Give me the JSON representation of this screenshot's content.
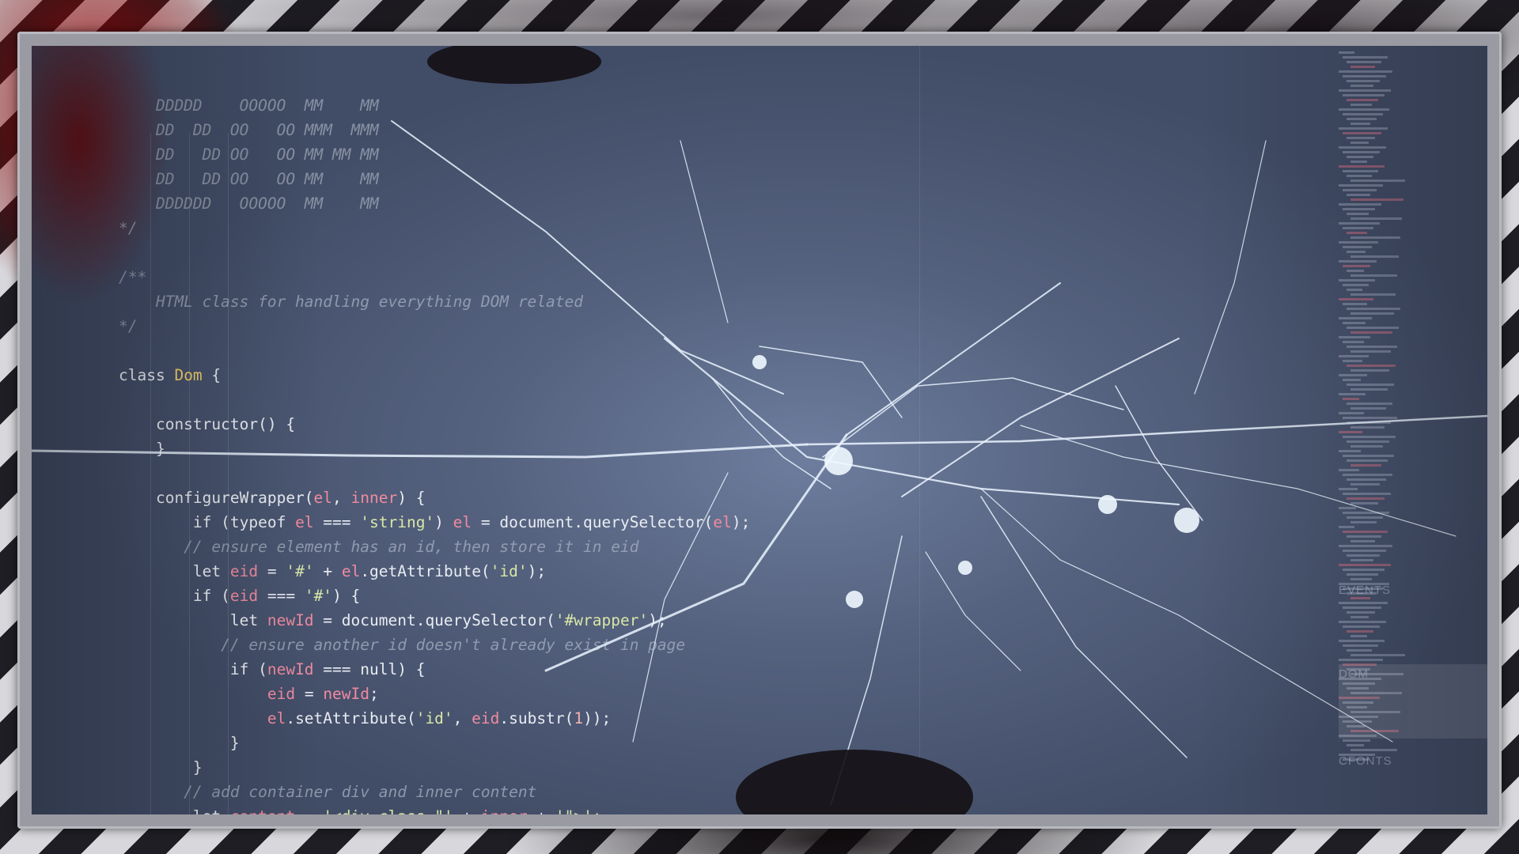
{
  "code_lines": [
    {
      "segs": [
        {
          "t": "    DDDDD    OOOOO  MM    MM",
          "c": "dim"
        }
      ]
    },
    {
      "segs": [
        {
          "t": "    DD  DD  OO   OO MMM  MMM",
          "c": "dim"
        }
      ]
    },
    {
      "segs": [
        {
          "t": "    DD   DD OO   OO MM MM MM",
          "c": "dim"
        }
      ]
    },
    {
      "segs": [
        {
          "t": "    DD   DD OO   OO MM    MM",
          "c": "dim"
        }
      ]
    },
    {
      "segs": [
        {
          "t": "    DDDDDD   OOOOO  MM    MM",
          "c": "dim"
        }
      ]
    },
    {
      "segs": [
        {
          "t": "*/",
          "c": "dim"
        }
      ]
    },
    {
      "segs": []
    },
    {
      "segs": [
        {
          "t": "/**",
          "c": "dim"
        }
      ]
    },
    {
      "segs": [
        {
          "t": "    HTML class for handling everything DOM related",
          "c": "cmt"
        }
      ]
    },
    {
      "segs": [
        {
          "t": "*/",
          "c": "dim"
        }
      ]
    },
    {
      "segs": []
    },
    {
      "segs": [
        {
          "t": "class ",
          "c": "kw"
        },
        {
          "t": "Dom",
          "c": "cls"
        },
        {
          "t": " {",
          "c": "kw"
        }
      ]
    },
    {
      "segs": []
    },
    {
      "segs": [
        {
          "t": "    constructor() {",
          "c": "fn"
        }
      ]
    },
    {
      "segs": [
        {
          "t": "    }",
          "c": "fn"
        }
      ]
    },
    {
      "segs": []
    },
    {
      "segs": [
        {
          "t": "    configureWrapper(",
          "c": "fn"
        },
        {
          "t": "el",
          "c": "var"
        },
        {
          "t": ", ",
          "c": "fn"
        },
        {
          "t": "inner",
          "c": "var"
        },
        {
          "t": ") {",
          "c": "fn"
        }
      ]
    },
    {
      "segs": [
        {
          "t": "        if (typeof ",
          "c": "kw"
        },
        {
          "t": "el",
          "c": "var"
        },
        {
          "t": " === ",
          "c": "kw"
        },
        {
          "t": "'string'",
          "c": "str"
        },
        {
          "t": ") ",
          "c": "kw"
        },
        {
          "t": "el",
          "c": "var"
        },
        {
          "t": " = ",
          "c": "kw"
        },
        {
          "t": "document",
          "c": "fn"
        },
        {
          "t": ".querySelector(",
          "c": "fn"
        },
        {
          "t": "el",
          "c": "var"
        },
        {
          "t": ");",
          "c": "fn"
        }
      ]
    },
    {
      "segs": [
        {
          "t": "       // ensure element has an id, then store it in eid",
          "c": "cmt"
        }
      ]
    },
    {
      "segs": [
        {
          "t": "        let ",
          "c": "kw"
        },
        {
          "t": "eid",
          "c": "var"
        },
        {
          "t": " = ",
          "c": "kw"
        },
        {
          "t": "'#'",
          "c": "str"
        },
        {
          "t": " + ",
          "c": "kw"
        },
        {
          "t": "el",
          "c": "var"
        },
        {
          "t": ".getAttribute(",
          "c": "fn"
        },
        {
          "t": "'id'",
          "c": "str"
        },
        {
          "t": ");",
          "c": "fn"
        }
      ]
    },
    {
      "segs": [
        {
          "t": "        if (",
          "c": "kw"
        },
        {
          "t": "eid",
          "c": "var"
        },
        {
          "t": " === ",
          "c": "kw"
        },
        {
          "t": "'#'",
          "c": "str"
        },
        {
          "t": ") {",
          "c": "kw"
        }
      ]
    },
    {
      "segs": [
        {
          "t": "            let ",
          "c": "kw"
        },
        {
          "t": "newId",
          "c": "var"
        },
        {
          "t": " = ",
          "c": "kw"
        },
        {
          "t": "document",
          "c": "fn"
        },
        {
          "t": ".querySelector(",
          "c": "fn"
        },
        {
          "t": "'#wrapper'",
          "c": "str"
        },
        {
          "t": ");",
          "c": "fn"
        }
      ]
    },
    {
      "segs": [
        {
          "t": "           // ensure another id doesn't already exist in page",
          "c": "cmt"
        }
      ]
    },
    {
      "segs": [
        {
          "t": "            if (",
          "c": "kw"
        },
        {
          "t": "newId",
          "c": "var"
        },
        {
          "t": " === ",
          "c": "kw"
        },
        {
          "t": "null",
          "c": "kw"
        },
        {
          "t": ") {",
          "c": "kw"
        }
      ]
    },
    {
      "segs": [
        {
          "t": "                ",
          "c": "kw"
        },
        {
          "t": "eid",
          "c": "var"
        },
        {
          "t": " = ",
          "c": "kw"
        },
        {
          "t": "newId",
          "c": "var"
        },
        {
          "t": ";",
          "c": "kw"
        }
      ]
    },
    {
      "segs": [
        {
          "t": "                ",
          "c": "kw"
        },
        {
          "t": "el",
          "c": "var"
        },
        {
          "t": ".setAttribute(",
          "c": "fn"
        },
        {
          "t": "'id'",
          "c": "str"
        },
        {
          "t": ", ",
          "c": "fn"
        },
        {
          "t": "eid",
          "c": "var"
        },
        {
          "t": ".substr(",
          "c": "fn"
        },
        {
          "t": "1",
          "c": "num"
        },
        {
          "t": "));",
          "c": "fn"
        }
      ]
    },
    {
      "segs": [
        {
          "t": "            }",
          "c": "kw"
        }
      ]
    },
    {
      "segs": [
        {
          "t": "        }",
          "c": "kw"
        }
      ]
    },
    {
      "segs": [
        {
          "t": "       // add container div and inner content",
          "c": "cmt"
        }
      ]
    },
    {
      "segs": [
        {
          "t": "        let ",
          "c": "kw"
        },
        {
          "t": "content",
          "c": "var"
        },
        {
          "t": " = ",
          "c": "kw"
        },
        {
          "t": "'<div class=\"'",
          "c": "str"
        },
        {
          "t": " + ",
          "c": "kw"
        },
        {
          "t": "inner",
          "c": "var"
        },
        {
          "t": " + ",
          "c": "kw"
        },
        {
          "t": "'\">';",
          "c": "str"
        }
      ]
    }
  ],
  "minimap": {
    "labels": [
      "EVENTS",
      "DOM",
      "CFONTS"
    ]
  },
  "colors": {
    "screen": "#55627f",
    "keyword": "#e8ecf2",
    "class_name": "#f2cf6e",
    "string": "#d8e6a8",
    "variable": "#f08aa0",
    "comment": "#a7b0c2"
  }
}
